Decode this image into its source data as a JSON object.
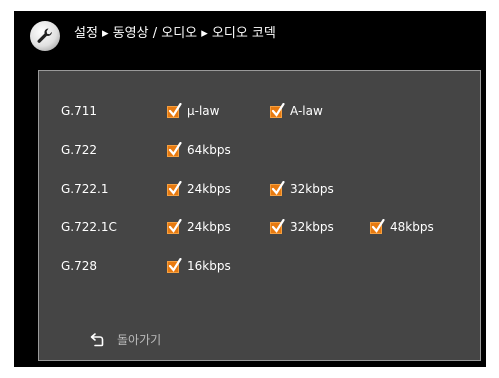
{
  "header": {
    "breadcrumb": "설정 ▸ 동영상 / 오디오 ▸ 오디오 코덱",
    "icon": "wrench-icon"
  },
  "codecs": [
    {
      "name": "G.711",
      "options": [
        "μ-law",
        "A-law"
      ]
    },
    {
      "name": "G.722",
      "options": [
        "64kbps"
      ]
    },
    {
      "name": "G.722.1",
      "options": [
        "24kbps",
        "32kbps"
      ]
    },
    {
      "name": "G.722.1C",
      "options": [
        "24kbps",
        "32kbps",
        "48kbps"
      ]
    },
    {
      "name": "G.728",
      "options": [
        "16kbps"
      ]
    }
  ],
  "back": {
    "label": "돌아가기",
    "icon": "back-arrow-icon"
  },
  "colors": {
    "background": "#000000",
    "panel": "#454545",
    "checkbox": "#e77a10"
  }
}
